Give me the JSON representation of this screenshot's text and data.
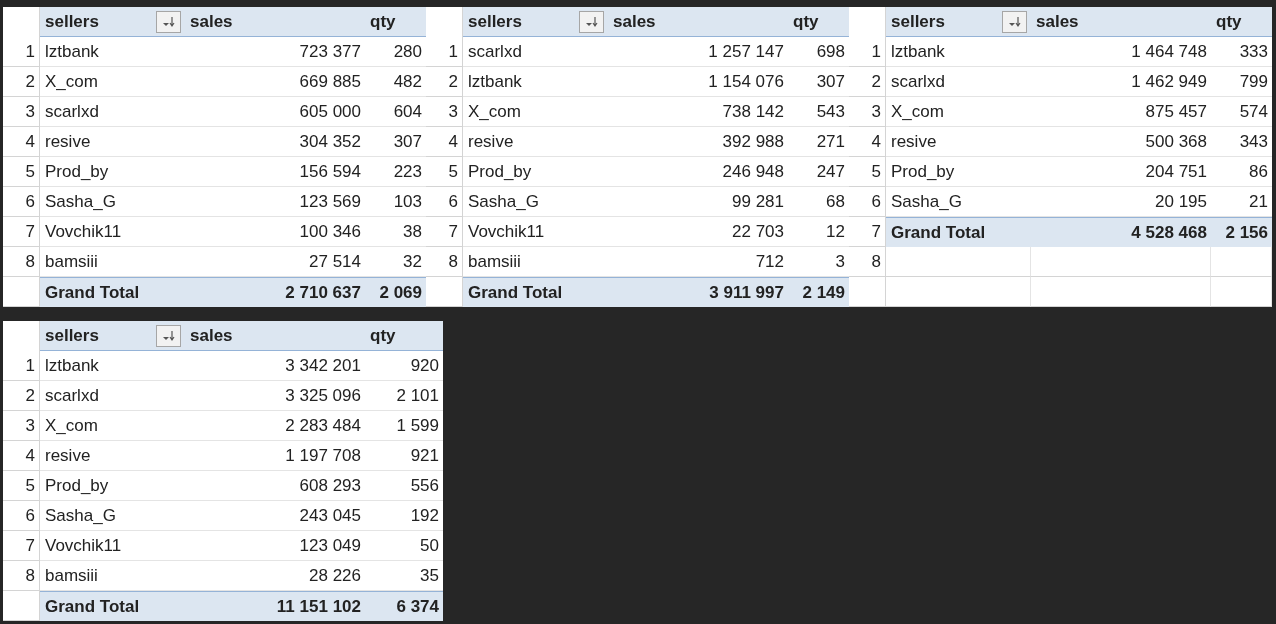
{
  "tables": [
    {
      "columns": [
        {
          "label": "sellers",
          "filter": true
        },
        {
          "label": "sales",
          "filter": false
        },
        {
          "label": "qty",
          "filter": false
        }
      ],
      "rows": [
        {
          "kind": "data",
          "number": "1",
          "seller": "lztbank",
          "sales": "723 377",
          "qty": "280"
        },
        {
          "kind": "data",
          "number": "2",
          "seller": "X_com",
          "sales": "669 885",
          "qty": "482"
        },
        {
          "kind": "data",
          "number": "3",
          "seller": "scarlxd",
          "sales": "605 000",
          "qty": "604"
        },
        {
          "kind": "data",
          "number": "4",
          "seller": "resive",
          "sales": "304 352",
          "qty": "307"
        },
        {
          "kind": "data",
          "number": "5",
          "seller": "Prod_by",
          "sales": "156 594",
          "qty": "223"
        },
        {
          "kind": "data",
          "number": "6",
          "seller": "Sasha_G",
          "sales": "123 569",
          "qty": "103"
        },
        {
          "kind": "data",
          "number": "7",
          "seller": "Vovchik11",
          "sales": "100 346",
          "qty": "38"
        },
        {
          "kind": "data",
          "number": "8",
          "seller": "bamsiii",
          "sales": "27 514",
          "qty": "32"
        },
        {
          "kind": "total",
          "seller": "Grand Total",
          "sales": "2 710 637",
          "qty": "2 069"
        }
      ]
    },
    {
      "columns": [
        {
          "label": "sellers",
          "filter": true
        },
        {
          "label": "sales",
          "filter": false
        },
        {
          "label": "qty",
          "filter": false
        }
      ],
      "rows": [
        {
          "kind": "data",
          "number": "1",
          "seller": "scarlxd",
          "sales": "1 257 147",
          "qty": "698"
        },
        {
          "kind": "data",
          "number": "2",
          "seller": "lztbank",
          "sales": "1 154 076",
          "qty": "307"
        },
        {
          "kind": "data",
          "number": "3",
          "seller": "X_com",
          "sales": "738 142",
          "qty": "543"
        },
        {
          "kind": "data",
          "number": "4",
          "seller": "resive",
          "sales": "392 988",
          "qty": "271"
        },
        {
          "kind": "data",
          "number": "5",
          "seller": "Prod_by",
          "sales": "246 948",
          "qty": "247"
        },
        {
          "kind": "data",
          "number": "6",
          "seller": "Sasha_G",
          "sales": "99 281",
          "qty": "68"
        },
        {
          "kind": "data",
          "number": "7",
          "seller": "Vovchik11",
          "sales": "22 703",
          "qty": "12"
        },
        {
          "kind": "data",
          "number": "8",
          "seller": "bamsiii",
          "sales": "712",
          "qty": "3"
        },
        {
          "kind": "total",
          "seller": "Grand Total",
          "sales": "3 911 997",
          "qty": "2 149"
        }
      ]
    },
    {
      "columns": [
        {
          "label": "sellers",
          "filter": true
        },
        {
          "label": "sales",
          "filter": false
        },
        {
          "label": "qty",
          "filter": false
        }
      ],
      "rows": [
        {
          "kind": "data",
          "number": "1",
          "seller": "lztbank",
          "sales": "1 464 748",
          "qty": "333"
        },
        {
          "kind": "data",
          "number": "2",
          "seller": "scarlxd",
          "sales": "1 462 949",
          "qty": "799"
        },
        {
          "kind": "data",
          "number": "3",
          "seller": "X_com",
          "sales": "875 457",
          "qty": "574"
        },
        {
          "kind": "data",
          "number": "4",
          "seller": "resive",
          "sales": "500 368",
          "qty": "343"
        },
        {
          "kind": "data",
          "number": "5",
          "seller": "Prod_by",
          "sales": "204 751",
          "qty": "86"
        },
        {
          "kind": "data",
          "number": "6",
          "seller": "Sasha_G",
          "sales": "20 195",
          "qty": "21"
        },
        {
          "kind": "total",
          "number": "7",
          "seller": "Grand Total",
          "sales": "4 528 468",
          "qty": "2 156"
        },
        {
          "kind": "empty",
          "number": "8"
        },
        {
          "kind": "empty"
        }
      ]
    },
    {
      "columns": [
        {
          "label": "sellers",
          "filter": true
        },
        {
          "label": "sales",
          "filter": false
        },
        {
          "label": "qty",
          "filter": false
        }
      ],
      "rows": [
        {
          "kind": "data",
          "number": "1",
          "seller": "lztbank",
          "sales": "3 342 201",
          "qty": "920"
        },
        {
          "kind": "data",
          "number": "2",
          "seller": "scarlxd",
          "sales": "3 325 096",
          "qty": "2 101"
        },
        {
          "kind": "data",
          "number": "3",
          "seller": "X_com",
          "sales": "2 283 484",
          "qty": "1 599"
        },
        {
          "kind": "data",
          "number": "4",
          "seller": "resive",
          "sales": "1 197 708",
          "qty": "921"
        },
        {
          "kind": "data",
          "number": "5",
          "seller": "Prod_by",
          "sales": "608 293",
          "qty": "556"
        },
        {
          "kind": "data",
          "number": "6",
          "seller": "Sasha_G",
          "sales": "243 045",
          "qty": "192"
        },
        {
          "kind": "data",
          "number": "7",
          "seller": "Vovchik11",
          "sales": "123 049",
          "qty": "50"
        },
        {
          "kind": "data",
          "number": "8",
          "seller": "bamsiii",
          "sales": "28 226",
          "qty": "35"
        },
        {
          "kind": "total",
          "seller": "Grand Total",
          "sales": "11 151 102",
          "qty": "6 374"
        }
      ]
    }
  ]
}
